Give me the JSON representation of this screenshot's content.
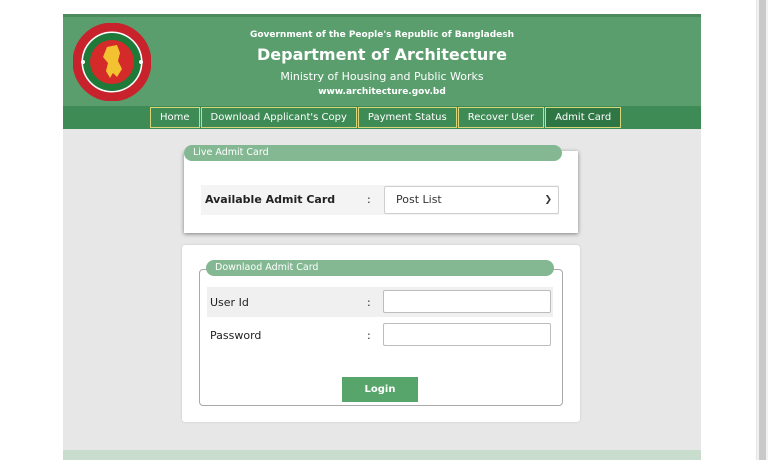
{
  "header": {
    "government": "Government of the People's Republic of Bangladesh",
    "department": "Department of Architecture",
    "ministry": "Ministry of Housing and Public Works",
    "website": "www.architecture.gov.bd",
    "logo_icon": "bangladesh-government-seal-icon"
  },
  "nav": {
    "items": [
      {
        "label": "Home"
      },
      {
        "label": "Download Applicant's Copy"
      },
      {
        "label": "Payment Status"
      },
      {
        "label": "Recover User"
      },
      {
        "label": "Admit Card"
      }
    ],
    "active": "Admit Card"
  },
  "live_admit": {
    "legend": "Live Admit Card",
    "label": "Available Admit Card",
    "colon": ":",
    "select_value": "Post List"
  },
  "download_admit": {
    "legend": "Downlaod Admit Card",
    "user_label": "User Id",
    "password_label": "Password",
    "colon": ":",
    "user_value": "",
    "password_value": "",
    "login_label": "Login"
  },
  "colors": {
    "header_green": "#5b9e6e",
    "nav_green": "#3f8b55",
    "legend_green": "#84b893",
    "button_green": "#57a56a"
  }
}
